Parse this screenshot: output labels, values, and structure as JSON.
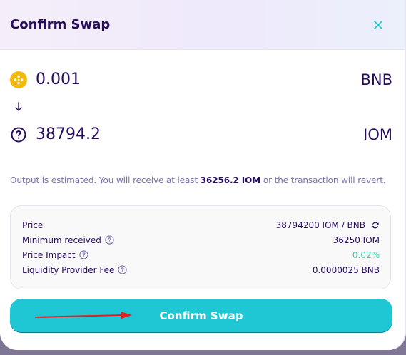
{
  "modal": {
    "title": "Confirm Swap",
    "close_icon": "close-icon"
  },
  "input_token": {
    "icon": "bnb-token-icon",
    "amount": "0.001",
    "symbol": "BNB"
  },
  "direction_icon": "arrow-down-icon",
  "output_token": {
    "icon": "unknown-token-icon",
    "amount": "38794.2",
    "symbol": "IOM"
  },
  "estimate": {
    "prefix": "Output is estimated. You will receive at least ",
    "amount": "36256.2 IOM",
    "suffix": " or the transaction will revert."
  },
  "details": {
    "price_label": "Price",
    "price_value": "38794200 IOM / BNB",
    "minimum_received_label": "Minimum received",
    "minimum_received_value": "36250 IOM",
    "price_impact_label": "Price Impact",
    "price_impact_value": "0.02%",
    "lp_fee_label": "Liquidity Provider Fee",
    "lp_fee_value": "0.0000025 BNB"
  },
  "confirm_button": {
    "label": "Confirm Swap"
  },
  "colors": {
    "text_primary": "#280d5f",
    "text_secondary": "#7a6eaa",
    "accent": "#1fc7d4",
    "success": "#31d0aa",
    "annotation_arrow": "#e02020"
  }
}
